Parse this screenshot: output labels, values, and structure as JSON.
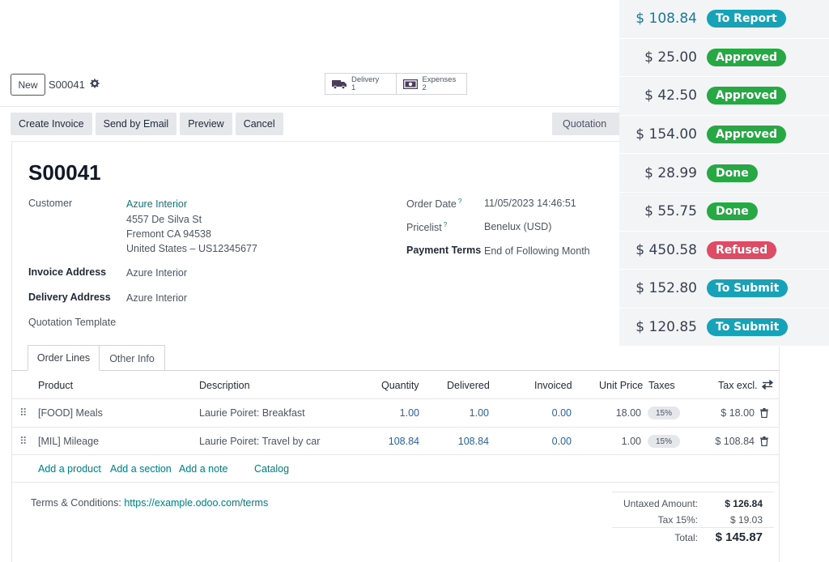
{
  "control_panel": {
    "new_label": "New",
    "record_name": "S00041",
    "smart_buttons": [
      {
        "label": "Delivery",
        "count": "1",
        "icon": "truck-icon"
      },
      {
        "label": "Expenses",
        "count": "2",
        "icon": "money-icon"
      }
    ]
  },
  "actions": {
    "create_invoice": "Create Invoice",
    "send_by_email": "Send by Email",
    "preview": "Preview",
    "cancel": "Cancel",
    "status": "Quotation"
  },
  "form": {
    "title": "S00041",
    "customer_label": "Customer",
    "customer_name": "Azure Interior",
    "address_line1": "4557 De Silva St",
    "address_line2": "Fremont CA 94538",
    "address_line3": "United States – US12345677",
    "invoice_address_label": "Invoice Address",
    "invoice_address": "Azure Interior",
    "delivery_address_label": "Delivery Address",
    "delivery_address": "Azure Interior",
    "quotation_template_label": "Quotation Template",
    "order_date_label": "Order Date",
    "order_date": "11/05/2023 14:46:51",
    "pricelist_label": "Pricelist",
    "pricelist": "Benelux (USD)",
    "payment_terms_label": "Payment Terms",
    "payment_terms": "End of Following Month",
    "help_mark": "?"
  },
  "tabs": {
    "order_lines": "Order Lines",
    "other_info": "Other Info"
  },
  "lines": {
    "headers": {
      "product": "Product",
      "description": "Description",
      "quantity": "Quantity",
      "delivered": "Delivered",
      "invoiced": "Invoiced",
      "unit_price": "Unit Price",
      "taxes": "Taxes",
      "tax_excl": "Tax excl."
    },
    "rows": [
      {
        "product": "[FOOD] Meals",
        "description": "Laurie Poiret: Breakfast",
        "quantity": "1.00",
        "delivered": "1.00",
        "invoiced": "0.00",
        "unit_price": "18.00",
        "tax": "15%",
        "subtotal": "$ 18.00"
      },
      {
        "product": "[MIL] Mileage",
        "description": "Laurie Poiret: Travel by car",
        "quantity": "108.84",
        "delivered": "108.84",
        "invoiced": "0.00",
        "unit_price": "1.00",
        "tax": "15%",
        "subtotal": "$ 108.84"
      }
    ],
    "add_product": "Add a product",
    "add_section": "Add a section",
    "add_note": "Add a note",
    "catalog": "Catalog"
  },
  "terms": {
    "label": "Terms & Conditions:",
    "url": "https://example.odoo.com/terms"
  },
  "totals": {
    "untaxed_label": "Untaxed Amount:",
    "untaxed_value": "$ 126.84",
    "tax_label": "Tax 15%:",
    "tax_value": "$ 19.03",
    "total_label": "Total:",
    "total_value": "$ 145.87"
  },
  "expense_overlay": [
    {
      "amount": "$ 108.84",
      "status": "To Report",
      "color": "#17a2b8"
    },
    {
      "amount": "$ 25.00",
      "status": "Approved",
      "color": "#28a745"
    },
    {
      "amount": "$ 42.50",
      "status": "Approved",
      "color": "#28a745"
    },
    {
      "amount": "$ 154.00",
      "status": "Approved",
      "color": "#28a745"
    },
    {
      "amount": "$ 28.99",
      "status": "Done",
      "color": "#28a745"
    },
    {
      "amount": "$ 55.75",
      "status": "Done",
      "color": "#28a745"
    },
    {
      "amount": "$ 450.58",
      "status": "Refused",
      "color": "#dc4c64"
    },
    {
      "amount": "$ 152.80",
      "status": "To Submit",
      "color": "#17a2b8"
    },
    {
      "amount": "$ 120.85",
      "status": "To Submit",
      "color": "#17a2b8"
    }
  ],
  "colors": {
    "link": "#017e84",
    "number": "#2563a8",
    "highlight_amount": "#1e7896"
  }
}
